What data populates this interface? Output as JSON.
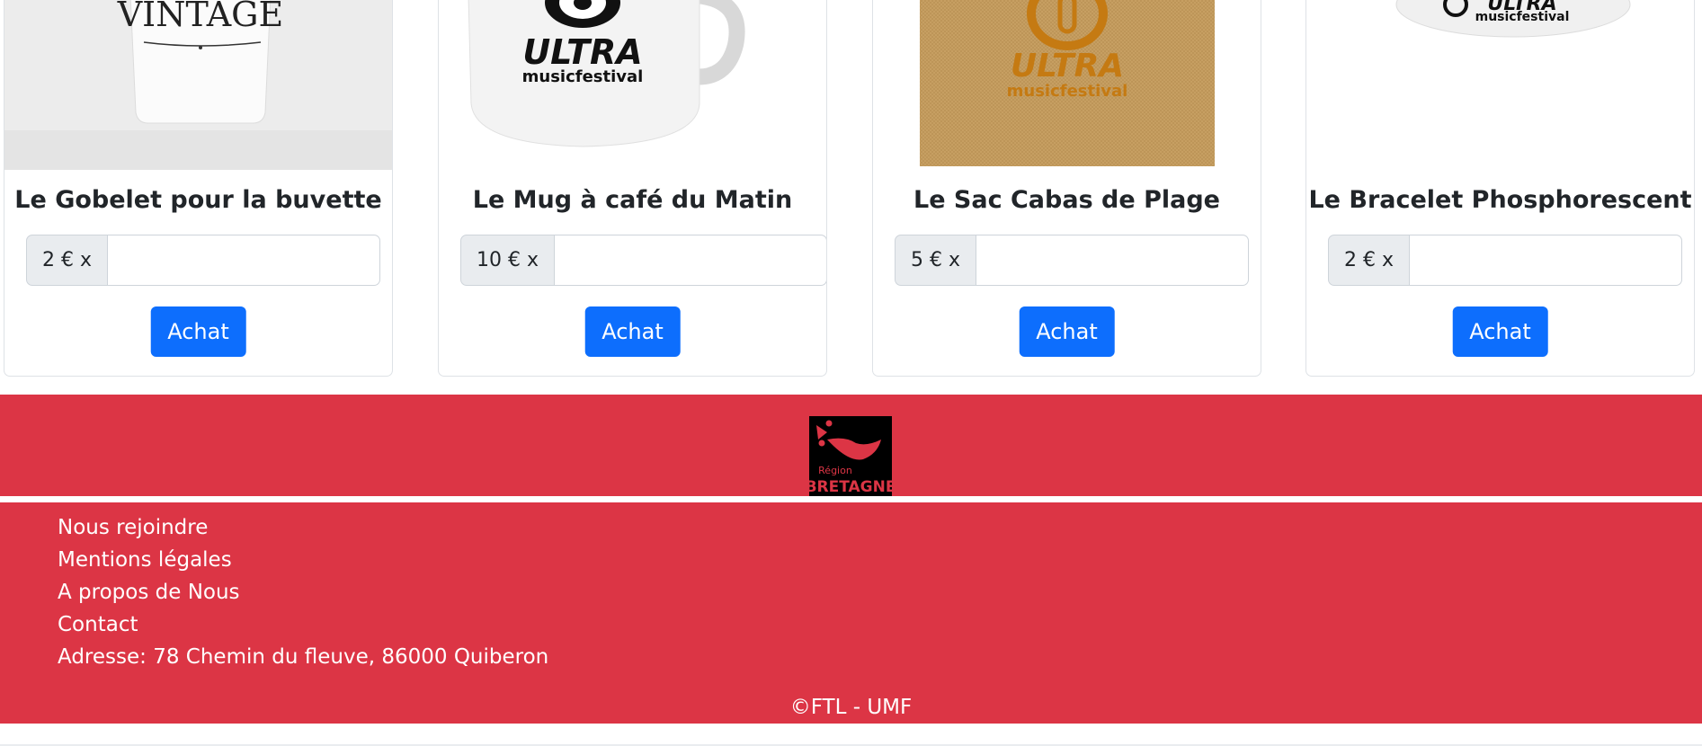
{
  "products": [
    {
      "title": "Le Gobelet pour la buvette",
      "price_prefix": "2 € x",
      "quantity": "",
      "buy_label": "Achat",
      "image_text": "VINTAGE"
    },
    {
      "title": "Le Mug à café du Matin",
      "price_prefix": "10 € x",
      "quantity": "",
      "buy_label": "Achat",
      "image_text": "ULTRA",
      "image_subtext": "musicfestival"
    },
    {
      "title": "Le Sac Cabas de Plage",
      "price_prefix": "5 € x",
      "quantity": "",
      "buy_label": "Achat",
      "image_text": "ULTRA",
      "image_subtext": "musicfestival"
    },
    {
      "title": "Le Bracelet Phosphorescent",
      "price_prefix": "2 € x",
      "quantity": "",
      "buy_label": "Achat",
      "image_text": "ULTRA",
      "image_subtext": "musicfestival"
    }
  ],
  "footer": {
    "logo_text_small": "Région",
    "logo_text_big": "BRETAGNE",
    "links": [
      "Nous rejoindre",
      "Mentions légales",
      "A propos de Nous",
      "Contact"
    ],
    "address": "Adresse: 78 Chemin du fleuve, 86000 Quiberon",
    "copyright": "©FTL - UMF"
  },
  "colors": {
    "primary_button": "#0d6efd",
    "footer_background": "#dc3545"
  }
}
